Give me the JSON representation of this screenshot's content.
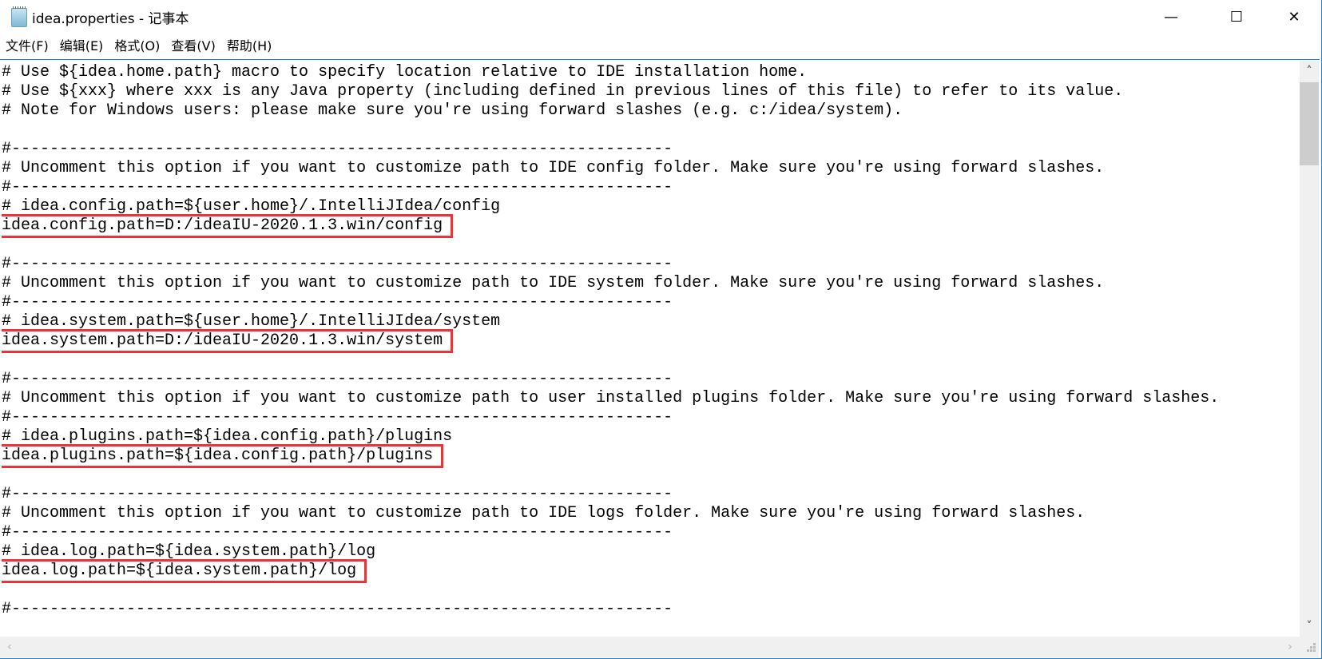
{
  "window": {
    "title": "idea.properties - 记事本",
    "icon": "notepad-icon",
    "controls": {
      "minimize": "—",
      "maximize": "☐",
      "close": "✕"
    }
  },
  "menu": [
    {
      "label": "文件(F)"
    },
    {
      "label": "编辑(E)"
    },
    {
      "label": "格式(O)"
    },
    {
      "label": "查看(V)"
    },
    {
      "label": "帮助(H)"
    }
  ],
  "highlight_color": "#ee3238",
  "lines": [
    {
      "text": "# Use ${idea.home.path} macro to specify location relative to IDE installation home."
    },
    {
      "text": "# Use ${xxx} where xxx is any Java property (including defined in previous lines of this file) to refer to its value."
    },
    {
      "text": "# Note for Windows users: please make sure you're using forward slashes (e.g. c:/idea/system)."
    },
    {
      "text": ""
    },
    {
      "text": "#---------------------------------------------------------------------"
    },
    {
      "text": "# Uncomment this option if you want to customize path to IDE config folder. Make sure you're using forward slashes."
    },
    {
      "text": "#---------------------------------------------------------------------"
    },
    {
      "text": "# idea.config.path=${user.home}/.IntelliJIdea/config"
    },
    {
      "text": "idea.config.path=D:/ideaIU-2020.1.3.win/config",
      "highlighted": true
    },
    {
      "text": ""
    },
    {
      "text": "#---------------------------------------------------------------------"
    },
    {
      "text": "# Uncomment this option if you want to customize path to IDE system folder. Make sure you're using forward slashes."
    },
    {
      "text": "#---------------------------------------------------------------------"
    },
    {
      "text": "# idea.system.path=${user.home}/.IntelliJIdea/system"
    },
    {
      "text": "idea.system.path=D:/ideaIU-2020.1.3.win/system",
      "highlighted": true
    },
    {
      "text": ""
    },
    {
      "text": "#---------------------------------------------------------------------"
    },
    {
      "text": "# Uncomment this option if you want to customize path to user installed plugins folder. Make sure you're using forward slashes."
    },
    {
      "text": "#---------------------------------------------------------------------"
    },
    {
      "text": "# idea.plugins.path=${idea.config.path}/plugins"
    },
    {
      "text": "idea.plugins.path=${idea.config.path}/plugins",
      "highlighted": true
    },
    {
      "text": ""
    },
    {
      "text": "#---------------------------------------------------------------------"
    },
    {
      "text": "# Uncomment this option if you want to customize path to IDE logs folder. Make sure you're using forward slashes."
    },
    {
      "text": "#---------------------------------------------------------------------"
    },
    {
      "text": "# idea.log.path=${idea.system.path}/log"
    },
    {
      "text": "idea.log.path=${idea.system.path}/log",
      "highlighted": true
    },
    {
      "text": ""
    },
    {
      "text": "#---------------------------------------------------------------------"
    }
  ]
}
